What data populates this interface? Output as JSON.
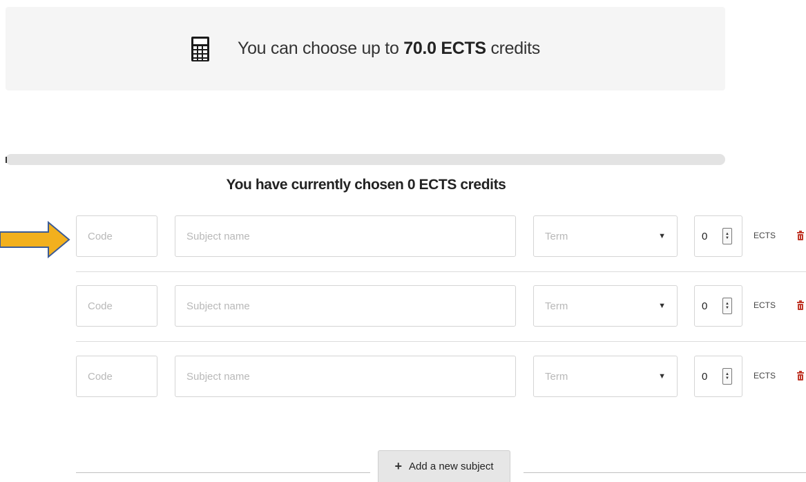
{
  "limit_banner": {
    "icon": "calculator-icon",
    "prefix": "You can choose up to",
    "amount": "70.0 ECTS",
    "suffix": "credits"
  },
  "progress": {
    "value": 0,
    "max": 70.0
  },
  "chosen_heading": "You have currently chosen 0 ECTS credits",
  "subject_rows": [
    {
      "code_placeholder": "Code",
      "name_placeholder": "Subject name",
      "term_placeholder": "Term",
      "ects_value": "0",
      "ects_label": "ECTS"
    },
    {
      "code_placeholder": "Code",
      "name_placeholder": "Subject name",
      "term_placeholder": "Term",
      "ects_value": "0",
      "ects_label": "ECTS"
    },
    {
      "code_placeholder": "Code",
      "name_placeholder": "Subject name",
      "term_placeholder": "Term",
      "ects_value": "0",
      "ects_label": "ECTS"
    }
  ],
  "add_button": {
    "icon": "plus-icon",
    "label": "Add a new subject"
  },
  "colors": {
    "arrow_fill": "#F2B01E",
    "arrow_stroke": "#3B5B96",
    "trash": "#C0392B"
  }
}
